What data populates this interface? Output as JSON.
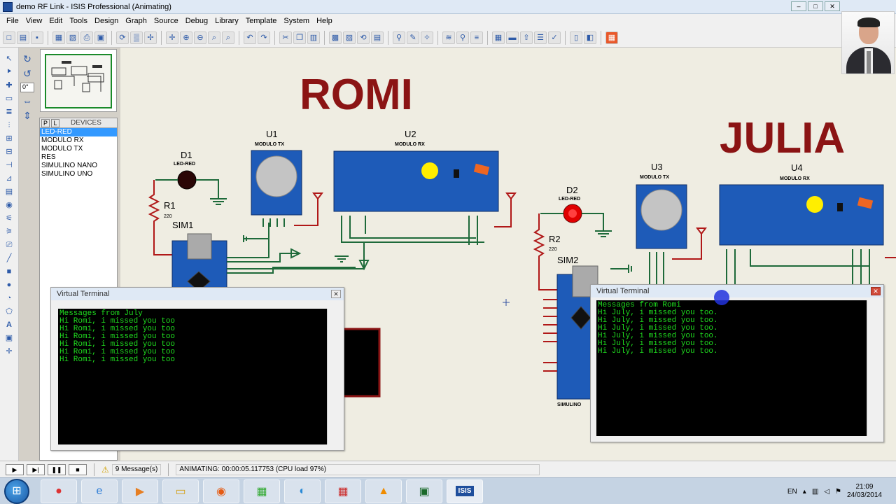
{
  "window": {
    "title": "demo RF Link - ISIS Professional (Animating)"
  },
  "menu": [
    "File",
    "View",
    "Edit",
    "Tools",
    "Design",
    "Graph",
    "Source",
    "Debug",
    "Library",
    "Template",
    "System",
    "Help"
  ],
  "rotation_value": "0°",
  "devices_panel": {
    "tab_p": "P",
    "tab_l": "L",
    "title": "DEVICES",
    "items": [
      "LED-RED",
      "MODULO RX",
      "MODULO TX",
      "RES",
      "SIMULINO NANO",
      "SIMULINO UNO"
    ],
    "selected_index": 0
  },
  "schematic": {
    "label_left": "ROMI",
    "label_right": "JULIA",
    "components": {
      "d1": {
        "ref": "D1",
        "type": "LED-RED"
      },
      "r1": {
        "ref": "R1",
        "value": "220"
      },
      "sim1": {
        "ref": "SIM1"
      },
      "u1": {
        "ref": "U1",
        "type": "MODULO TX"
      },
      "u2": {
        "ref": "U2",
        "type": "MODULO RX"
      },
      "d2": {
        "ref": "D2",
        "type": "LED-RED"
      },
      "r2": {
        "ref": "R2",
        "value": "220"
      },
      "sim2": {
        "ref": "SIM2",
        "caption": "SIMULINO"
      },
      "u3": {
        "ref": "U3",
        "type": "MODULO TX"
      },
      "u4": {
        "ref": "U4",
        "type": "MODULO RX"
      }
    }
  },
  "terminals": {
    "left": {
      "title": "Virtual Terminal",
      "lines": [
        "Messages from July",
        "Hi Romi, i missed you too",
        "Hi Romi, i missed you too",
        "Hi Romi, i missed you too",
        "Hi Romi, i missed you too",
        "Hi Romi, i missed you too",
        "Hi Romi, i missed you too"
      ]
    },
    "right": {
      "title": "Virtual Terminal",
      "lines": [
        "Messages from Romi",
        "Hi July, i missed you too.",
        "Hi July, i missed you too.",
        "Hi July, i missed you too.",
        "Hi July, i missed you too.",
        "Hi July, i missed you too.",
        "Hi July, i missed you too."
      ]
    }
  },
  "status": {
    "messages": "9 Message(s)",
    "animating": "ANIMATING: 00:00:05.117753 (CPU load 97%)"
  },
  "taskbar": {
    "lang": "EN",
    "time": "21:09",
    "date": "24/03/2014",
    "active_app_label": "ISIS"
  },
  "colors": {
    "wire": "#1e6a3a",
    "module_blue": "#1e5bb8",
    "label_red": "#8b1414",
    "terminal_text": "#1fdc1f"
  }
}
